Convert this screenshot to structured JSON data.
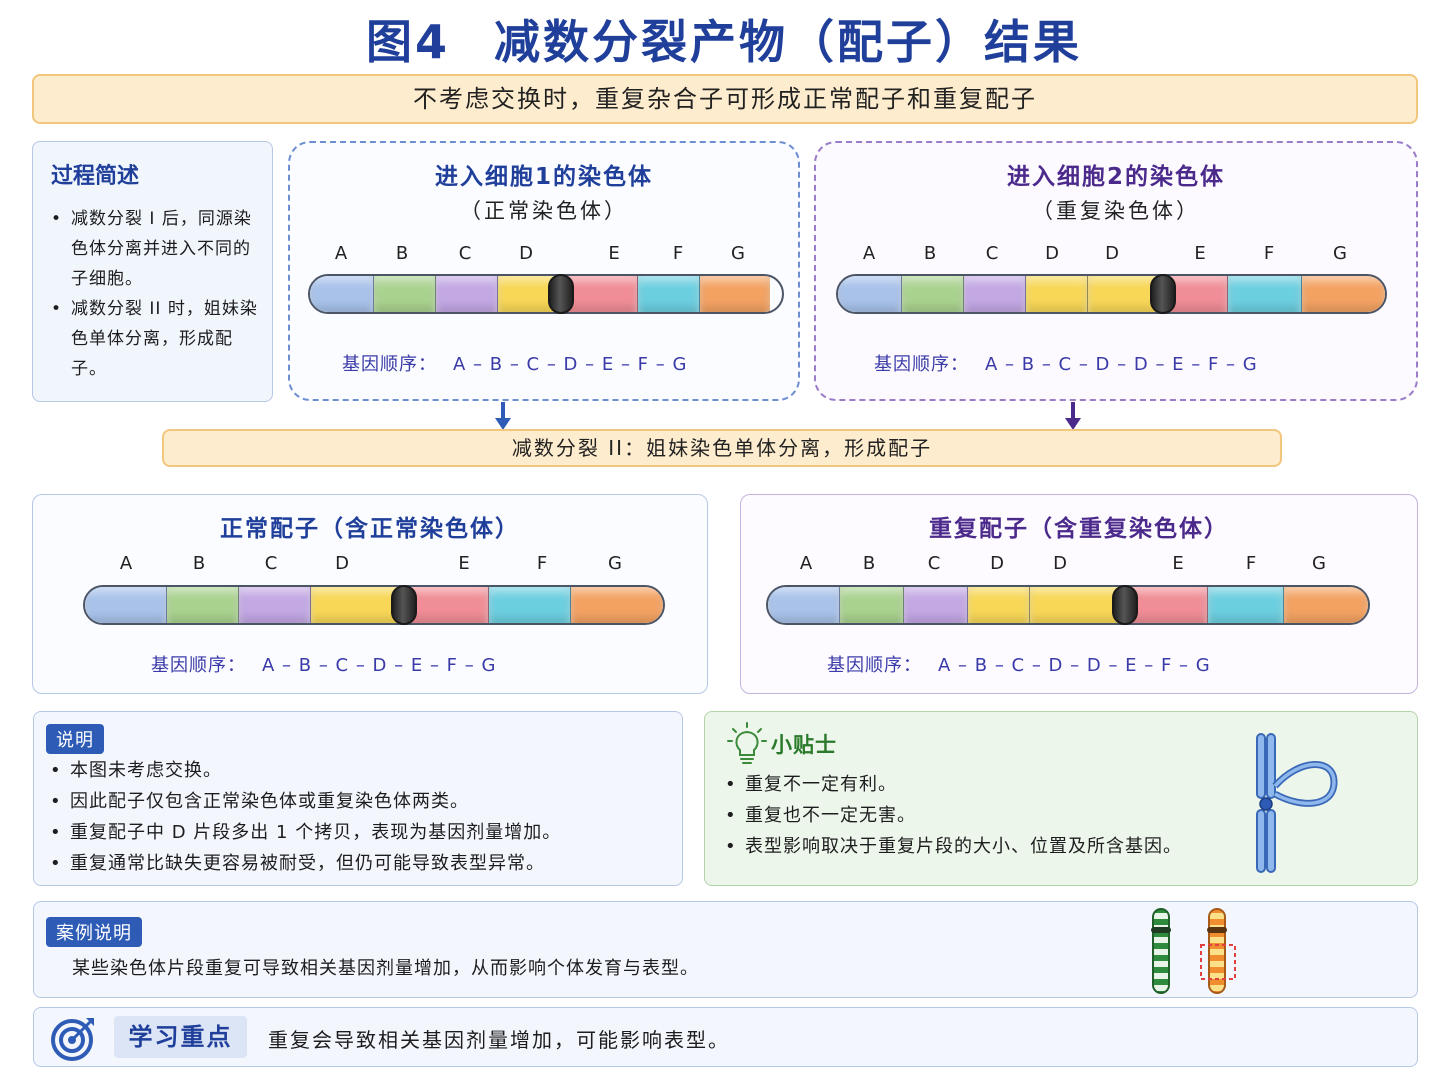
{
  "title": {
    "figure": "图4",
    "text": "减数分裂产物（配子）结果"
  },
  "subtitle": "不考虑交换时，重复杂合子可形成正常配子和重复配子",
  "process": {
    "heading": "过程简述",
    "items": [
      "减数分裂 I 后，同源染色体分离并进入不同的子细胞。",
      "减数分裂 II 时，姐妹染色单体分离，形成配子。"
    ]
  },
  "cell1": {
    "title": "进入细胞1的染色体",
    "subtitle": "（正常染色体）",
    "genes": [
      "A",
      "B",
      "C",
      "D",
      "E",
      "F",
      "G"
    ],
    "order_label": "基因顺序：",
    "order": "A – B – C – D – E – F – G"
  },
  "cell2": {
    "title": "进入细胞2的染色体",
    "subtitle": "（重复染色体）",
    "genes": [
      "A",
      "B",
      "C",
      "D",
      "D",
      "E",
      "F",
      "G"
    ],
    "order_label": "基因顺序：",
    "order": "A – B – C – D – D – E – F – G"
  },
  "meiosis2": "减数分裂 II：姐妹染色单体分离，形成配子",
  "gamete1": {
    "title": "正常配子（含正常染色体）",
    "genes": [
      "A",
      "B",
      "C",
      "D",
      "E",
      "F",
      "G"
    ],
    "order_label": "基因顺序：",
    "order": "A – B – C – D – E – F – G"
  },
  "gamete2": {
    "title": "重复配子（含重复染色体）",
    "genes": [
      "A",
      "B",
      "C",
      "D",
      "D",
      "E",
      "F",
      "G"
    ],
    "order_label": "基因顺序：",
    "order": "A – B – C – D – D – E – F – G"
  },
  "note": {
    "tag": "说明",
    "items": [
      "本图未考虑交换。",
      "因此配子仅包含正常染色体或重复染色体两类。",
      "重复配子中 D 片段多出 1 个拷贝，表现为基因剂量增加。",
      "重复通常比缺失更容易被耐受，但仍可能导致表型异常。"
    ]
  },
  "tips": {
    "title": "小贴士",
    "items": [
      "重复不一定有利。",
      "重复也不一定无害。",
      "表型影响取决于重复片段的大小、位置及所含基因。"
    ]
  },
  "case": {
    "tag": "案例说明",
    "text": "某些染色体片段重复可导致相关基因剂量增加，从而影响个体发育与表型。"
  },
  "key": {
    "label": "学习重点",
    "text": "重复会导致相关基因剂量增加，可能影响表型。"
  },
  "colors": {
    "A": "#a8c2ea",
    "B": "#a9d28f",
    "C": "#c3a8e4",
    "D": "#f8d757",
    "E": "#f08d96",
    "F": "#6ccfe0",
    "G": "#f3a262",
    "title": "#1f3f9a",
    "purple": "#4c2a8c",
    "arrow_blue": "#2d5bb5",
    "arrow_purple": "#4c2a8c"
  }
}
